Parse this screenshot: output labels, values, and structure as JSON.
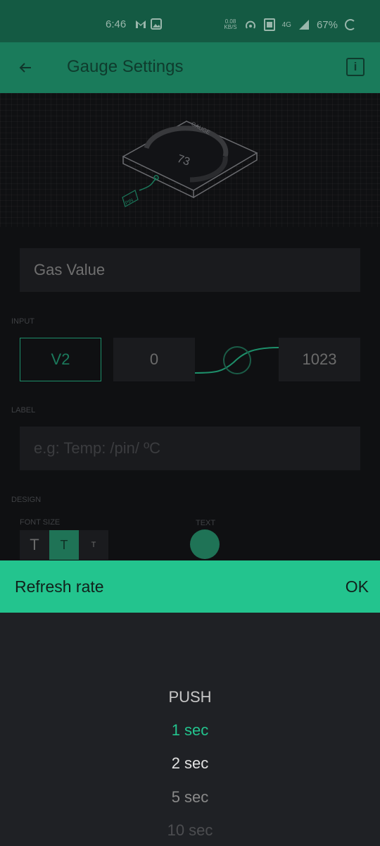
{
  "status": {
    "time": "6:46",
    "speed": "0.08",
    "speed_unit": "KB/S",
    "net": "4G",
    "battery": "67%"
  },
  "appbar": {
    "title": "Gauge Settings"
  },
  "preview": {
    "gauge_label": "GAUGE",
    "gauge_value": "73",
    "pin_label": "PIN"
  },
  "name_field": {
    "value": "Gas Value"
  },
  "input": {
    "section_label": "INPUT",
    "pin": "V2",
    "min": "0",
    "max": "1023"
  },
  "label": {
    "section_label": "LABEL",
    "placeholder": "e.g: Temp: /pin/ ºC"
  },
  "design": {
    "section_label": "DESIGN",
    "font_size_label": "FONT SIZE",
    "text_label": "TEXT",
    "font_glyph": "T",
    "accent": "#23c48e"
  },
  "sheet": {
    "title": "Refresh rate",
    "ok": "OK"
  },
  "picker": {
    "options": [
      "PUSH",
      "1 sec",
      "2 sec",
      "5 sec",
      "10 sec"
    ],
    "selected": "1 sec"
  }
}
